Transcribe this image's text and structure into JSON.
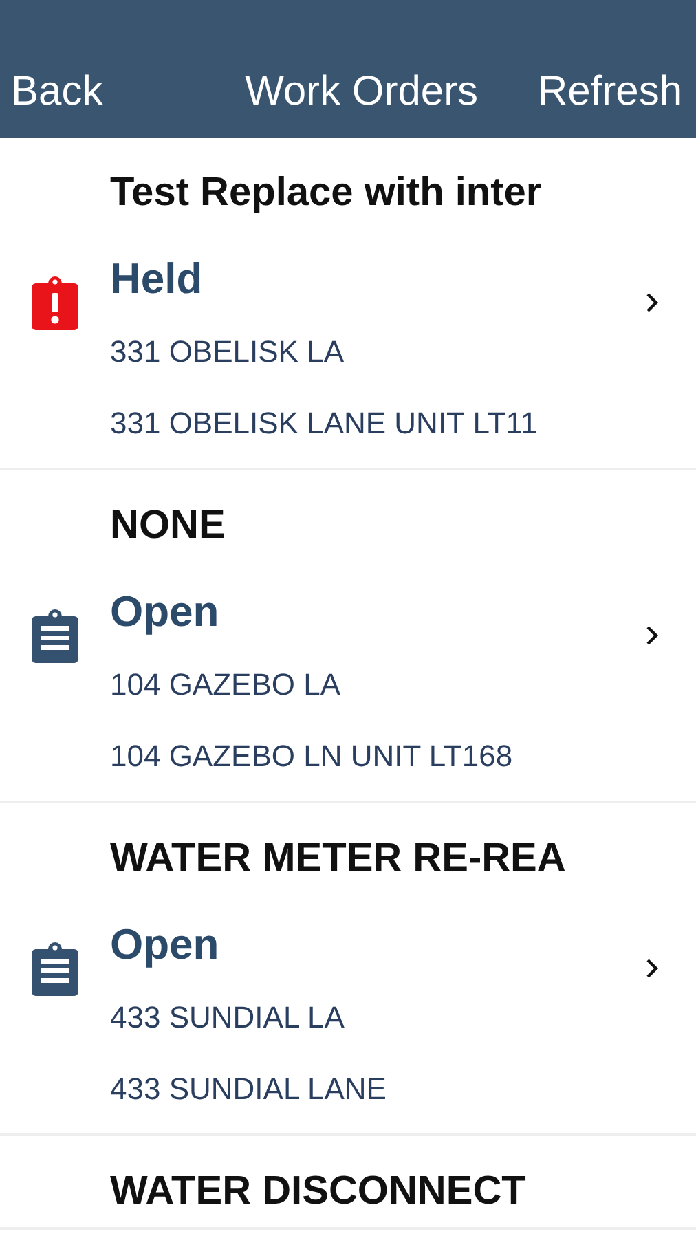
{
  "header": {
    "back": "Back",
    "title": "Work Orders",
    "refresh": "Refresh"
  },
  "work_orders": [
    {
      "title": "Test Replace with inter",
      "kind": "held",
      "status": "Held",
      "address": "331 OBELISK LA",
      "service_address": "331 OBELISK LANE UNIT LT11"
    },
    {
      "title": "NONE",
      "kind": "open",
      "status": "Open",
      "address": "104 GAZEBO LA",
      "service_address": "104 GAZEBO LN UNIT LT168"
    },
    {
      "title": "WATER METER RE-REA",
      "kind": "open",
      "status": "Open",
      "address": "433 SUNDIAL LA",
      "service_address": "433 SUNDIAL LANE"
    },
    {
      "title": "WATER DISCONNECT"
    }
  ]
}
